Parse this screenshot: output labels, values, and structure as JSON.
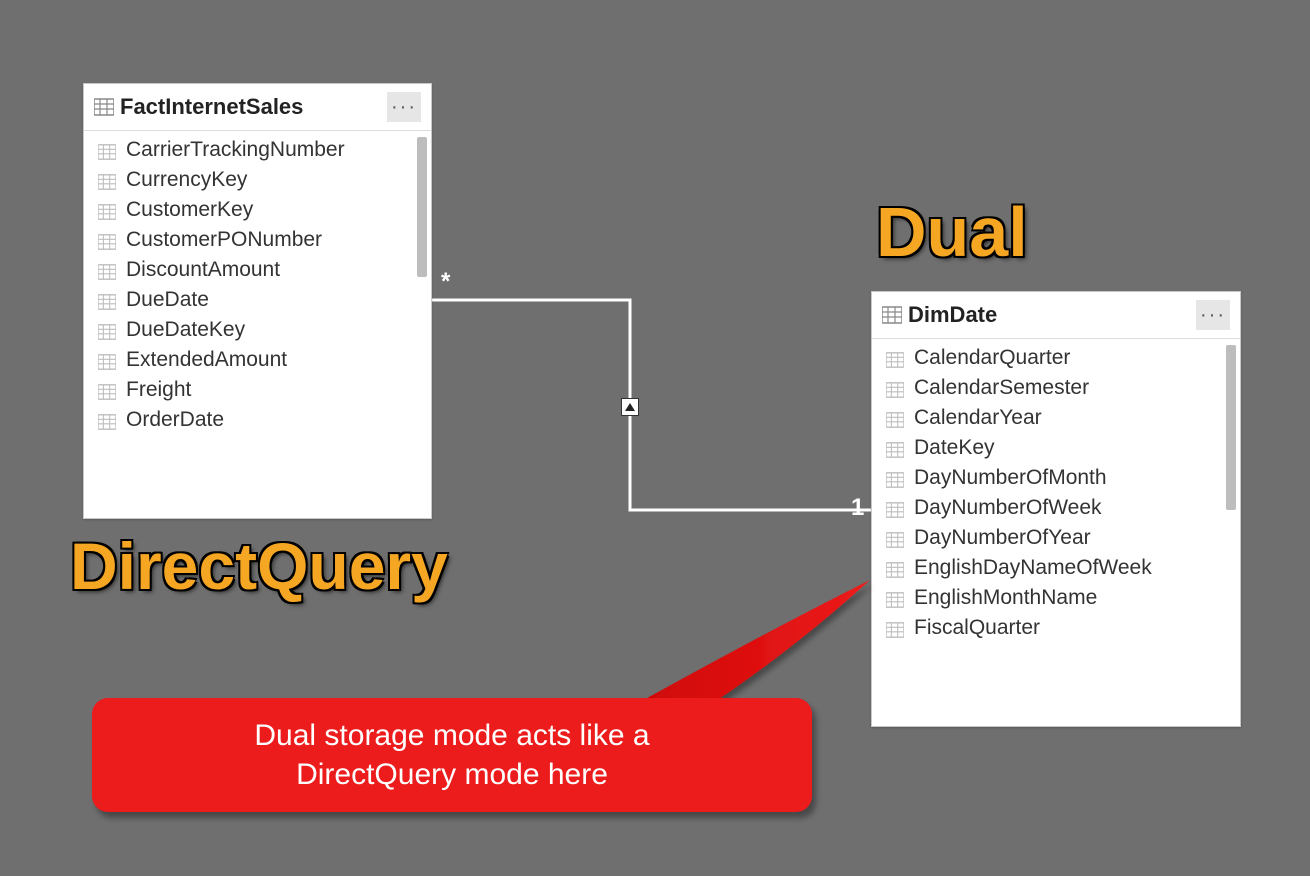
{
  "tables": {
    "fact": {
      "title": "FactInternetSales",
      "fields": [
        "CarrierTrackingNumber",
        "CurrencyKey",
        "CustomerKey",
        "CustomerPONumber",
        "DiscountAmount",
        "DueDate",
        "DueDateKey",
        "ExtendedAmount",
        "Freight",
        "OrderDate"
      ]
    },
    "dim": {
      "title": "DimDate",
      "fields": [
        "CalendarQuarter",
        "CalendarSemester",
        "CalendarYear",
        "DateKey",
        "DayNumberOfMonth",
        "DayNumberOfWeek",
        "DayNumberOfYear",
        "EnglishDayNameOfWeek",
        "EnglishMonthName",
        "FiscalQuarter"
      ]
    }
  },
  "labels": {
    "direct_query": "DirectQuery",
    "dual": "Dual"
  },
  "relationship": {
    "many": "*",
    "one": "1"
  },
  "callout": {
    "line1": "Dual storage mode acts like a",
    "line2": "DirectQuery mode here"
  }
}
